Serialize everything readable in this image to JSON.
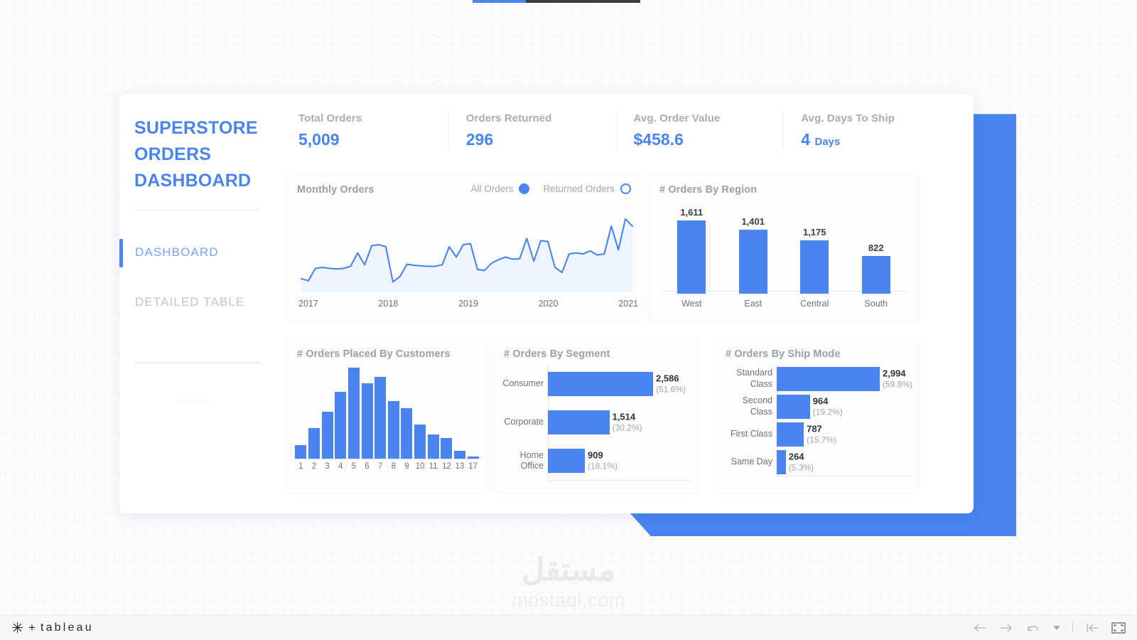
{
  "topbar": {
    "progress_percent": 32
  },
  "sidebar": {
    "title_lines": [
      "SUPERSTORE",
      "ORDERS",
      "DASHBOARD"
    ],
    "nav": [
      {
        "label": "DASHBOARD",
        "active": true
      },
      {
        "label": "DETAILED TABLE",
        "active": false
      }
    ]
  },
  "kpis": [
    {
      "label": "Total Orders",
      "value": "5,009",
      "unit": ""
    },
    {
      "label": "Orders Returned",
      "value": "296",
      "unit": ""
    },
    {
      "label": "Avg. Order Value",
      "value": "$458.6",
      "unit": ""
    },
    {
      "label": "Avg. Days To Ship",
      "value": "4",
      "unit": "Days"
    }
  ],
  "panels": {
    "monthly": {
      "title": "Monthly Orders",
      "toggles": [
        {
          "label": "All Orders",
          "selected": true
        },
        {
          "label": "Returned Orders",
          "selected": false
        }
      ]
    },
    "region": {
      "title": "# Orders By Region"
    },
    "customers": {
      "title": "# Orders Placed By Customers"
    },
    "segment": {
      "title": "# Orders By Segment"
    },
    "shipmode": {
      "title": "# Orders By Ship Mode"
    }
  },
  "watermark": {
    "arabic": "مستقل",
    "latin": "mostaql.com"
  },
  "bottom": {
    "logo_text": "tableau",
    "icons": [
      {
        "name": "back-arrow-icon"
      },
      {
        "name": "forward-arrow-icon"
      },
      {
        "name": "revert-icon"
      },
      {
        "name": "revert-dropdown-icon"
      },
      {
        "name": "reset-to-start-icon"
      },
      {
        "name": "fullscreen-icon"
      }
    ]
  },
  "colors": {
    "accent": "#4a84f0",
    "muted": "#a8adb6",
    "value_dark": "#2f343b"
  },
  "chart_data": [
    {
      "type": "line",
      "id": "monthly_orders",
      "title": "Monthly Orders",
      "xlabel": "",
      "ylabel": "",
      "grid": false,
      "legend": [
        "All Orders",
        "Returned Orders"
      ],
      "legend_position": "top-right",
      "tick_labels": [
        "2017",
        "2018",
        "2019",
        "2020",
        "2021"
      ],
      "x": [
        0,
        1,
        2,
        3,
        4,
        5,
        6,
        7,
        8,
        9,
        10,
        11,
        12,
        13,
        14,
        15,
        16,
        17,
        18,
        19,
        20,
        21,
        22,
        23,
        24,
        25,
        26,
        27,
        28,
        29,
        30,
        31,
        32,
        33,
        34,
        35,
        36,
        37,
        38,
        39,
        40,
        41,
        42,
        43,
        44,
        45,
        46,
        47
      ],
      "values": [
        18,
        14,
        38,
        40,
        38,
        37,
        38,
        42,
        68,
        45,
        82,
        84,
        80,
        12,
        22,
        46,
        44,
        43,
        42,
        42,
        45,
        80,
        60,
        84,
        86,
        36,
        34,
        48,
        55,
        60,
        56,
        57,
        96,
        52,
        92,
        90,
        40,
        30,
        66,
        68,
        66,
        72,
        64,
        66,
        120,
        74,
        134,
        120
      ]
    },
    {
      "type": "bar",
      "id": "orders_by_region",
      "title": "# Orders By Region",
      "categories": [
        "West",
        "East",
        "Central",
        "South"
      ],
      "values": [
        1611,
        1401,
        1175,
        822
      ],
      "value_labels": [
        "1,611",
        "1,401",
        "1,175",
        "822"
      ],
      "xlabel": "",
      "ylabel": "",
      "grid": false
    },
    {
      "type": "bar",
      "id": "orders_placed_by_customers",
      "title": "# Orders Placed By Customers",
      "categories": [
        "1",
        "2",
        "3",
        "4",
        "5",
        "6",
        "7",
        "8",
        "9",
        "10",
        "11",
        "12",
        "13",
        "17"
      ],
      "values": [
        17,
        38,
        58,
        82,
        112,
        93,
        101,
        71,
        62,
        42,
        30,
        25,
        10,
        3
      ],
      "xlabel": "",
      "ylabel": "",
      "grid": false
    },
    {
      "type": "bar",
      "id": "orders_by_segment",
      "orientation": "horizontal",
      "title": "# Orders By Segment",
      "categories": [
        "Consumer",
        "Corporate",
        "Home Office"
      ],
      "values": [
        2586,
        1514,
        909
      ],
      "value_labels": [
        "2,586",
        "1,514",
        "909"
      ],
      "percent_labels": [
        "(51.6%)",
        "(30.2%)",
        "(18.1%)"
      ],
      "xlabel": "",
      "ylabel": "",
      "grid": false
    },
    {
      "type": "bar",
      "id": "orders_by_ship_mode",
      "orientation": "horizontal",
      "title": "# Orders By Ship Mode",
      "categories": [
        "Standard Class",
        "Second Class",
        "First Class",
        "Same Day"
      ],
      "values": [
        2994,
        964,
        787,
        264
      ],
      "value_labels": [
        "2,994",
        "964",
        "787",
        "264"
      ],
      "percent_labels": [
        "(59.8%)",
        "(19.2%)",
        "(15.7%)",
        "(5.3%)"
      ],
      "xlabel": "",
      "ylabel": "",
      "grid": false
    }
  ]
}
